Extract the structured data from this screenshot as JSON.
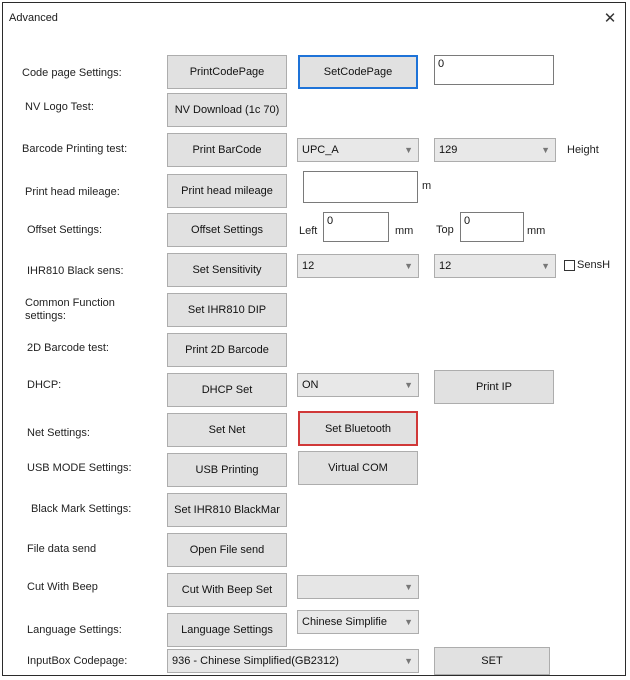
{
  "window": {
    "title": "Advanced",
    "close": "✕"
  },
  "rows": {
    "codepage": {
      "label": "Code page Settings:",
      "btn1": "PrintCodePage",
      "btn2": "SetCodePage",
      "input": "0"
    },
    "nvlogo": {
      "label": "NV Logo Test:",
      "btn": "NV Download (1c 70)"
    },
    "barcode": {
      "label": "Barcode Printing test:",
      "btn": "Print BarCode",
      "combo1": "UPC_A",
      "combo2": "129",
      "height_label": "Height"
    },
    "mileage": {
      "label": "Print head mileage:",
      "btn": "Print head mileage",
      "input": "",
      "unit": "m"
    },
    "offset": {
      "label": "Offset Settings:",
      "btn": "Offset Settings",
      "left_label": "Left",
      "left_val": "0",
      "left_unit": "mm",
      "top_label": "Top",
      "top_val": "0",
      "top_unit": "mm"
    },
    "ihr": {
      "label": "IHR810 Black sens:",
      "btn": "Set Sensitivity",
      "combo1": "12",
      "combo2": "12",
      "check_label": "SensH"
    },
    "common": {
      "label": "Common Function settings:",
      "btn": "Set IHR810 DIP"
    },
    "barcode2d": {
      "label": "2D Barcode test:",
      "btn": "Print 2D Barcode"
    },
    "dhcp": {
      "label": "DHCP:",
      "btn": "DHCP Set",
      "combo": "ON",
      "btn2": "Print IP"
    },
    "net": {
      "label": "Net Settings:",
      "btn": "Set Net",
      "btn2": "Set Bluetooth"
    },
    "usb": {
      "label": "USB MODE Settings:",
      "btn": "USB Printing",
      "btn2": "Virtual COM"
    },
    "blackmark": {
      "label": "Black Mark Settings:",
      "btn": "Set IHR810 BlackMar"
    },
    "filedata": {
      "label": "File data send",
      "btn": "Open File send"
    },
    "cutbeep": {
      "label": "Cut With Beep",
      "btn": "Cut With Beep Set",
      "combo": ""
    },
    "language": {
      "label": "Language Settings:",
      "btn": "Language Settings",
      "combo": "Chinese Simplifie"
    },
    "inputbox": {
      "label": "InputBox Codepage:",
      "combo": "936 - Chinese Simplified(GB2312)",
      "btn": "SET"
    }
  }
}
